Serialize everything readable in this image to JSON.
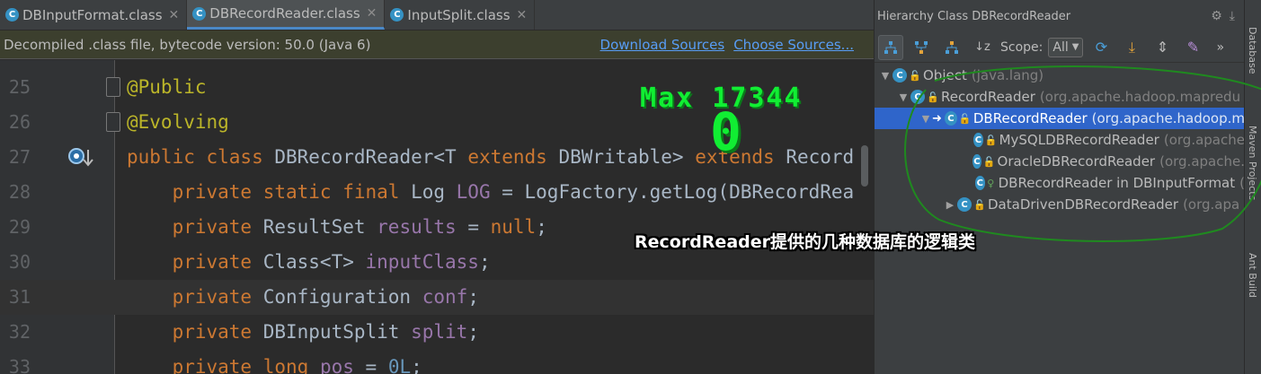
{
  "tabs": [
    {
      "label": "DBInputFormat.class",
      "active": false
    },
    {
      "label": "DBRecordReader.class",
      "active": true
    },
    {
      "label": "InputSplit.class",
      "active": false
    }
  ],
  "banner": {
    "text": "Decompiled .class file, bytecode version: 50.0 (Java 6)",
    "download_label": "Download Sources",
    "choose_label": "Choose Sources..."
  },
  "code_lines": [
    {
      "number": "25",
      "tokens": [
        {
          "cls": "ann",
          "text": "@Public"
        }
      ]
    },
    {
      "number": "26",
      "tokens": [
        {
          "cls": "ann",
          "text": "@Evolving"
        }
      ]
    },
    {
      "number": "27",
      "tokens": [
        {
          "cls": "kw",
          "text": "public class "
        },
        {
          "cls": "plain",
          "text": "DBRecordReader<T "
        },
        {
          "cls": "kw",
          "text": "extends "
        },
        {
          "cls": "plain",
          "text": "DBWritable> "
        },
        {
          "cls": "kw",
          "text": "extends "
        },
        {
          "cls": "plain",
          "text": "Record"
        }
      ]
    },
    {
      "number": "28",
      "tokens": [
        {
          "cls": "kw",
          "text": "    private static final "
        },
        {
          "cls": "plain",
          "text": "Log "
        },
        {
          "cls": "fld",
          "text": "LOG"
        },
        {
          "cls": "plain",
          "text": " = LogFactory.getLog(DBRecordRea"
        }
      ]
    },
    {
      "number": "29",
      "tokens": [
        {
          "cls": "kw",
          "text": "    private "
        },
        {
          "cls": "plain",
          "text": "ResultSet "
        },
        {
          "cls": "fld",
          "text": "results"
        },
        {
          "cls": "plain",
          "text": " = "
        },
        {
          "cls": "kw",
          "text": "null"
        },
        {
          "cls": "plain",
          "text": ";"
        }
      ]
    },
    {
      "number": "30",
      "tokens": [
        {
          "cls": "kw",
          "text": "    private "
        },
        {
          "cls": "plain",
          "text": "Class<T> "
        },
        {
          "cls": "fld",
          "text": "inputClass"
        },
        {
          "cls": "plain",
          "text": ";"
        }
      ]
    },
    {
      "number": "31",
      "tokens": [
        {
          "cls": "kw",
          "text": "    private "
        },
        {
          "cls": "plain",
          "text": "Configuration "
        },
        {
          "cls": "fld",
          "text": "conf"
        },
        {
          "cls": "plain",
          "text": ";"
        }
      ]
    },
    {
      "number": "32",
      "tokens": [
        {
          "cls": "kw",
          "text": "    private "
        },
        {
          "cls": "plain",
          "text": "DBInputSplit "
        },
        {
          "cls": "fld",
          "text": "split"
        },
        {
          "cls": "plain",
          "text": ";"
        }
      ]
    },
    {
      "number": "33",
      "tokens": [
        {
          "cls": "kw",
          "text": "    private long "
        },
        {
          "cls": "fld",
          "text": "pos"
        },
        {
          "cls": "plain",
          "text": " = "
        },
        {
          "cls": "num",
          "text": "0L"
        },
        {
          "cls": "plain",
          "text": ";"
        }
      ]
    }
  ],
  "current_line": "31",
  "overlay": {
    "max_text": "Max 17344",
    "score": "0",
    "caption": "RecordReader提供的几种数据库的逻辑类"
  },
  "hierarchy": {
    "title": "Hierarchy Class DBRecordReader",
    "scope_label": "Scope:",
    "scope_value": "All",
    "overflow": "»",
    "nodes": [
      {
        "name": "Object",
        "pkg": "(java.lang)",
        "arrow": "down"
      },
      {
        "name": "RecordReader",
        "pkg": "(org.apache.hadoop.mapredu",
        "arrow": "down"
      },
      {
        "name": "DBRecordReader",
        "pkg": "(org.apache.hadoop.m",
        "arrow": "down",
        "selected": true
      },
      {
        "name": "MySQLDBRecordReader",
        "pkg": "(org.apache",
        "arrow": ""
      },
      {
        "name": "OracleDBRecordReader",
        "pkg": "(org.apache.",
        "arrow": ""
      },
      {
        "name": "DBRecordReader in DBInputFormat",
        "pkg": "(",
        "arrow": ""
      },
      {
        "name": "DataDrivenDBRecordReader",
        "pkg": "(org.apa",
        "arrow": "right"
      }
    ]
  },
  "side_strip": [
    "Database",
    "Maven Projects",
    "Ant Build"
  ],
  "colors": {
    "accent_blue": "#4a88c7",
    "selection": "#2f65ca",
    "overlay_green": "#11ee33",
    "circle_green": "#1f8a1f"
  }
}
